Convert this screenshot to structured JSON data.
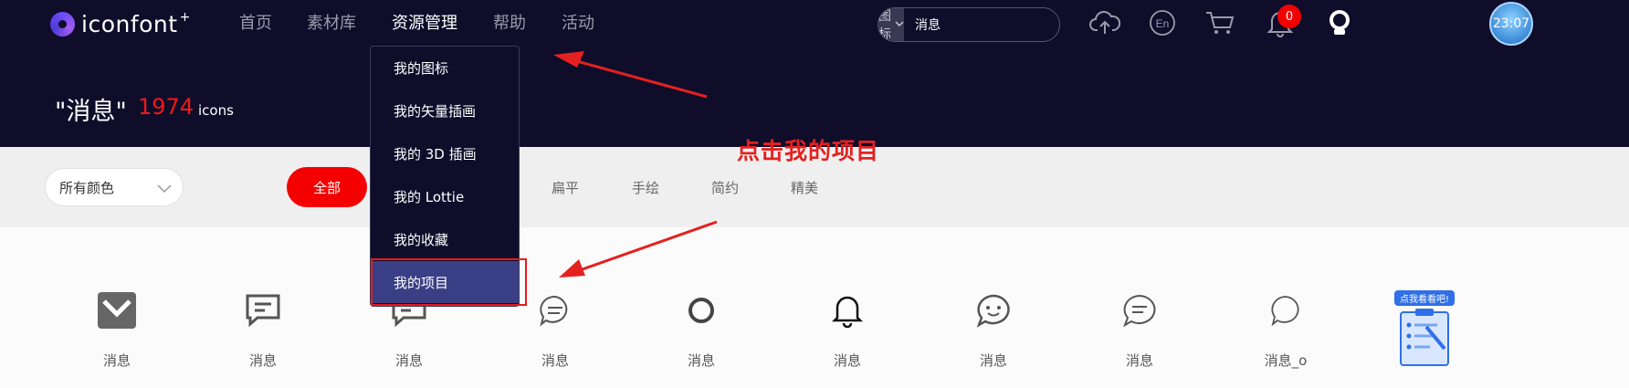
{
  "header": {
    "logo_text": "iconfont",
    "logo_plus": "+",
    "nav": [
      "首页",
      "素材库",
      "资源管理",
      "帮助",
      "活动"
    ],
    "active_nav": "资源管理",
    "search": {
      "type_label": "图标",
      "query": "消息"
    },
    "notification_count": "0",
    "avatar_time": "23:07"
  },
  "result": {
    "title": "\"消息\"",
    "count": "1974",
    "unit": "icons"
  },
  "filters": {
    "color_select": "所有颜色",
    "all_label": "全部",
    "tabs": [
      "扁平",
      "手绘",
      "简约",
      "精美"
    ]
  },
  "dropdown": {
    "items": [
      "我的图标",
      "我的矢量插画",
      "我的 3D 插画",
      "我的 Lottie",
      "我的收藏",
      "我的项目"
    ],
    "highlighted": "我的项目"
  },
  "annotation": {
    "text": "点击我的项目",
    "color": "#e52020"
  },
  "icons": [
    {
      "label": "消息",
      "icon": "envelope-icon"
    },
    {
      "label": "消息",
      "icon": "chat-square-icon"
    },
    {
      "label": "消息",
      "icon": "chat-square-icon"
    },
    {
      "label": "消息",
      "icon": "chat-bubble-lines-icon"
    },
    {
      "label": "消息",
      "icon": "ring-icon"
    },
    {
      "label": "消息",
      "icon": "bell-icon"
    },
    {
      "label": "消息",
      "icon": "smile-bubble-icon"
    },
    {
      "label": "消息",
      "icon": "chat-bubble-lines-icon"
    },
    {
      "label": "消息_o",
      "icon": "chat-bubble-outline-icon"
    }
  ],
  "promo": {
    "label": "点我看看吧!"
  },
  "colors": {
    "header_bg": "#0f0d2a",
    "accent_red": "#f50000",
    "highlight": "#3a3f85"
  }
}
